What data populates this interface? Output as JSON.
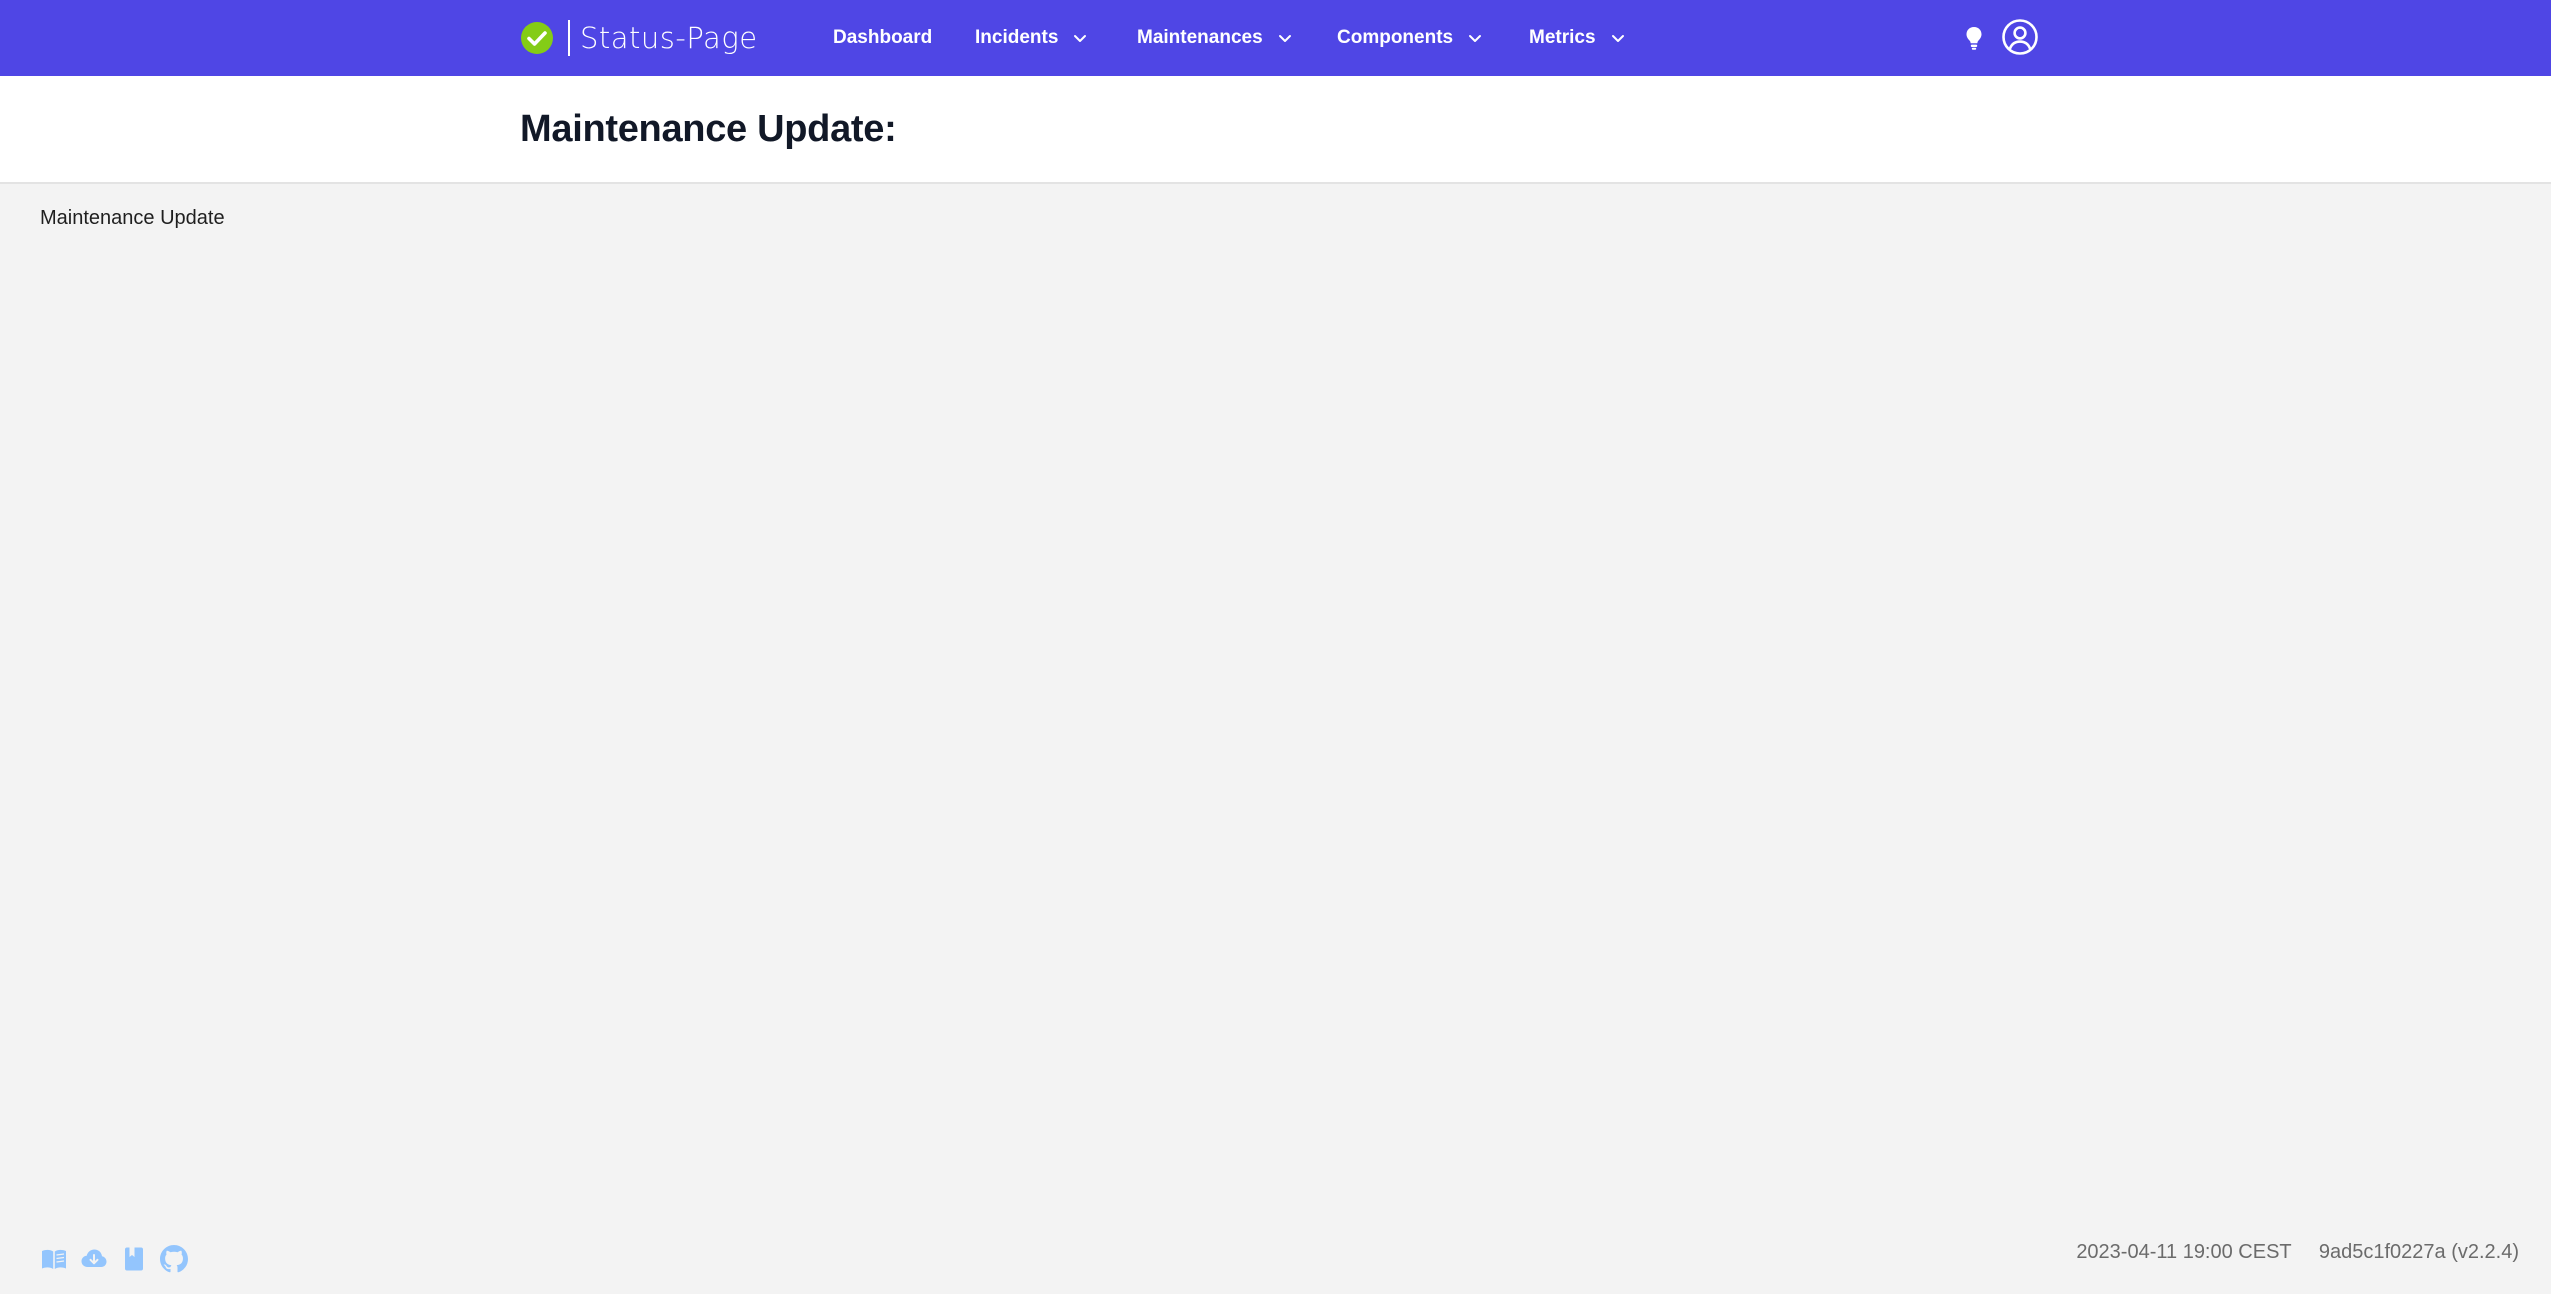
{
  "brand": {
    "name": "Status-Page",
    "logo_icon": "check-circle-icon",
    "logo_color": "#84cc16"
  },
  "colors": {
    "navbar_bg": "#4f46e5",
    "page_bg": "#f3f3f3",
    "header_bg": "#ffffff",
    "footer_icon": "#93c5fd"
  },
  "nav": {
    "items": [
      {
        "label": "Dashboard",
        "has_dropdown": false
      },
      {
        "label": "Incidents",
        "has_dropdown": true
      },
      {
        "label": "Maintenances",
        "has_dropdown": true
      },
      {
        "label": "Components",
        "has_dropdown": true
      },
      {
        "label": "Metrics",
        "has_dropdown": true
      }
    ],
    "right_icons": [
      "lightbulb-icon",
      "user-circle-icon"
    ]
  },
  "header": {
    "title": "Maintenance Update:"
  },
  "main": {
    "text": "Maintenance Update"
  },
  "footer": {
    "icons": [
      "book-open-icon",
      "cloud-download-icon",
      "bookmark-icon",
      "github-icon"
    ],
    "timestamp": "2023-04-11 19:00 CEST",
    "version": "9ad5c1f0227a (v2.2.4)"
  }
}
